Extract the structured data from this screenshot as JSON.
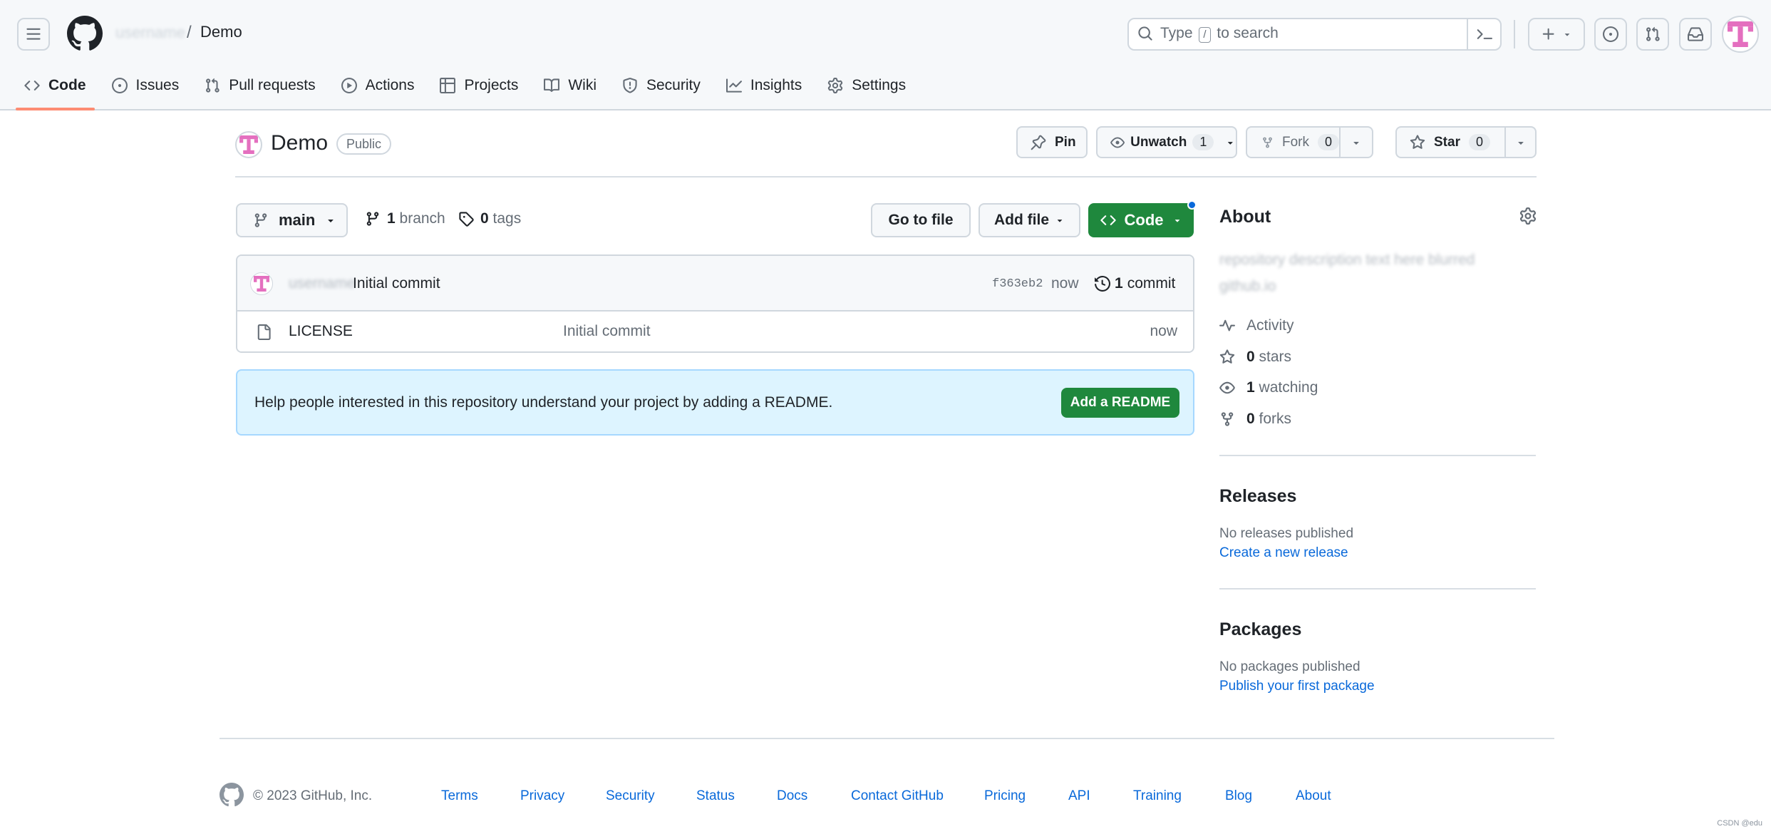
{
  "header": {
    "owner": "username",
    "separator": "/",
    "repo": "Demo",
    "search": {
      "prefix": "Type",
      "key": "/",
      "suffix": "to search"
    }
  },
  "tabs": [
    {
      "label": "Code",
      "icon": "code-icon",
      "active": true
    },
    {
      "label": "Issues",
      "icon": "issue-icon",
      "active": false
    },
    {
      "label": "Pull requests",
      "icon": "pull-request-icon",
      "active": false
    },
    {
      "label": "Actions",
      "icon": "play-icon",
      "active": false
    },
    {
      "label": "Projects",
      "icon": "table-icon",
      "active": false
    },
    {
      "label": "Wiki",
      "icon": "book-icon",
      "active": false
    },
    {
      "label": "Security",
      "icon": "shield-icon",
      "active": false
    },
    {
      "label": "Insights",
      "icon": "graph-icon",
      "active": false
    },
    {
      "label": "Settings",
      "icon": "gear-icon",
      "active": false
    }
  ],
  "repo": {
    "name": "Demo",
    "visibility": "Public",
    "pin_label": "Pin",
    "unwatch_label": "Unwatch",
    "watch_count": "1",
    "fork_label": "Fork",
    "fork_count": "0",
    "star_label": "Star",
    "star_count": "0"
  },
  "branch_bar": {
    "branch": "main",
    "branch_count": "1",
    "branch_label": "branch",
    "tag_count": "0",
    "tag_label": "tags",
    "goto_label": "Go to file",
    "addfile_label": "Add file",
    "code_label": "Code"
  },
  "latest_commit": {
    "author": "username",
    "message": "Initial commit",
    "sha": "f363eb2",
    "time": "now",
    "count_number": "1",
    "count_label": "commit"
  },
  "files": [
    {
      "name": "LICENSE",
      "message": "Initial commit",
      "time": "now"
    }
  ],
  "readme_banner": {
    "text": "Help people interested in this repository understand your project by adding a README.",
    "button": "Add a README"
  },
  "about": {
    "heading": "About",
    "description_line1": "repository description text here blurred",
    "description_line2": "github.io",
    "activity": "Activity",
    "stars_count": "0",
    "stars_label": "stars",
    "watching_count": "1",
    "watching_label": "watching",
    "forks_count": "0",
    "forks_label": "forks"
  },
  "releases": {
    "heading": "Releases",
    "empty": "No releases published",
    "link": "Create a new release"
  },
  "packages": {
    "heading": "Packages",
    "empty": "No packages published",
    "link": "Publish your first package"
  },
  "footer": {
    "copyright": "© 2023 GitHub, Inc.",
    "links": [
      "Terms",
      "Privacy",
      "Security",
      "Status",
      "Docs",
      "Contact GitHub",
      "Pricing",
      "API",
      "Training",
      "Blog",
      "About"
    ]
  },
  "watermark": "CSDN @edu",
  "colors": {
    "accent_green": "#1f883d",
    "link_blue": "#0969da",
    "tab_underline": "#fd8c73",
    "readme_bg": "#ddf4ff",
    "avatar_pink": "#e46fbf"
  }
}
